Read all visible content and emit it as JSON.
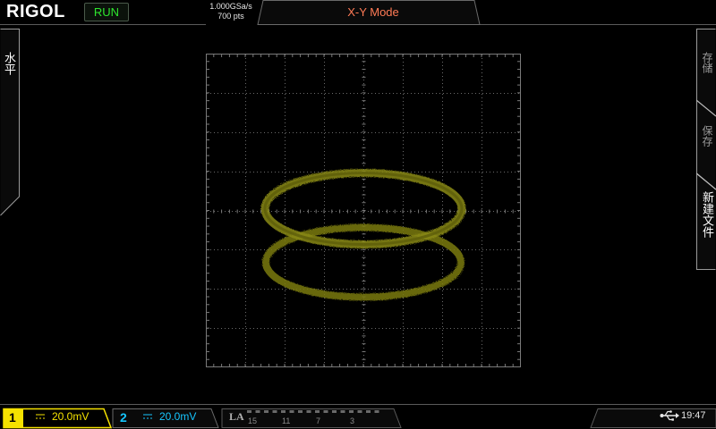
{
  "topbar": {
    "brand": "RIGOL",
    "run_status": "RUN",
    "sample_rate": "1.000GSa/s",
    "memory_depth": "700 pts",
    "mode_title": "X-Y Mode"
  },
  "left_tab": {
    "label": "水平"
  },
  "right_menu": {
    "items": [
      {
        "label": "存储"
      },
      {
        "label": "保存"
      },
      {
        "label": "新建文件"
      }
    ]
  },
  "display": {
    "grid_divisions": {
      "horizontal": 8,
      "vertical": 8
    },
    "trace_shape": "ellipse",
    "trace_color": "#8a8a14"
  },
  "bottombar": {
    "ch1": {
      "number": "1",
      "scale": "20.0mV",
      "color": "#f5e200"
    },
    "ch2": {
      "number": "2",
      "scale": "20.0mV",
      "color": "#16c6ff"
    },
    "la": {
      "label": "LA",
      "channel_numbers": [
        "15",
        "11",
        "7",
        "3"
      ]
    },
    "time": "19:47"
  },
  "colors": {
    "accent_mode": "#ff7a55",
    "run_green": "#2ee62e",
    "grid_line": "#6a6a6a",
    "panel_border": "#5a5a5a"
  },
  "icons": {
    "usb": "usb-icon",
    "coupling_dc": "dc-coupling-icon"
  }
}
